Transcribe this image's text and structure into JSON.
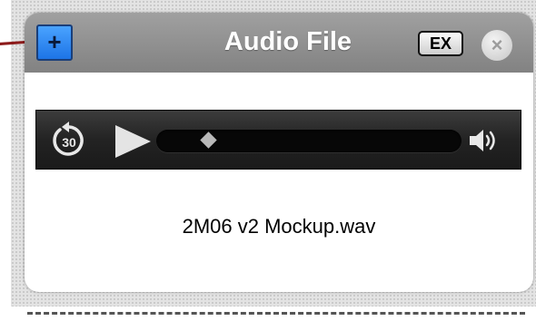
{
  "panel": {
    "title": "Audio File",
    "add_button_label": "+",
    "ex_button_label": "EX",
    "close_button_label": "×"
  },
  "player": {
    "skip_back_seconds": "30",
    "playhead_position_fraction": 0.17,
    "state": "paused"
  },
  "file": {
    "name": "2M06 v2 Mockup.wav"
  },
  "colors": {
    "title_bar": "#8f8f8f",
    "add_button": "#2f8cf2",
    "connector_line": "#8c1a1a",
    "player_bar": "#2a2a2a"
  },
  "icons": [
    "plus-icon",
    "close-icon",
    "skip-back-30-icon",
    "play-icon",
    "volume-icon"
  ]
}
